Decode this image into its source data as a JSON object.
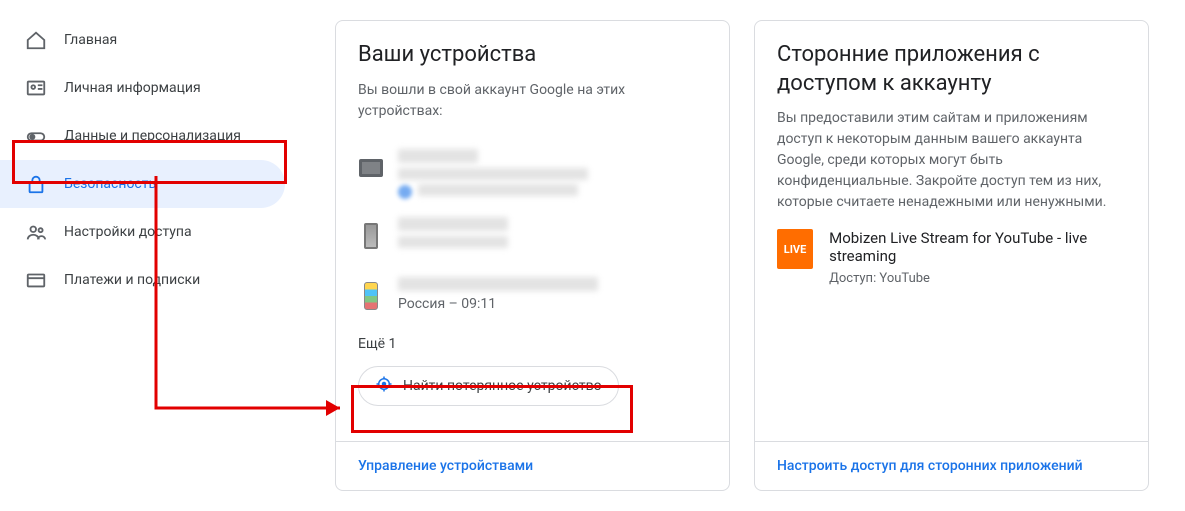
{
  "sidebar": {
    "items": [
      {
        "label": "Главная",
        "icon": "home-icon"
      },
      {
        "label": "Личная информация",
        "icon": "id-card-icon"
      },
      {
        "label": "Данные и персонализация",
        "icon": "toggle-icon"
      },
      {
        "label": "Безопасность",
        "icon": "lock-icon",
        "active": true
      },
      {
        "label": "Настройки доступа",
        "icon": "people-icon"
      },
      {
        "label": "Платежи и подписки",
        "icon": "card-icon"
      }
    ]
  },
  "devices_card": {
    "title": "Ваши устройства",
    "description": "Вы вошли в свой аккаунт Google на этих устройствах:",
    "devices": [
      {
        "name_redacted": true,
        "sub_redacted": true,
        "icon": "desktop"
      },
      {
        "name_redacted": true,
        "sub_redacted": true,
        "icon": "phone",
        "show_dot": true,
        "dot_color": "#1a73e8"
      },
      {
        "name_redacted": true,
        "sub": "Россия – 09:11",
        "icon": "samsung"
      }
    ],
    "more_label": "Ещё 1",
    "find_label": "Найти потерянное устройство",
    "footer_link": "Управление устройствами"
  },
  "apps_card": {
    "title": "Сторонние приложения с доступом к аккаунту",
    "description": "Вы предоставили этим сайтам и приложениям доступ к некоторым данным вашего аккаунта Google, среди которых могут быть конфиденциальные. Закройте доступ тем из них, которые считаете ненадежными или ненужными.",
    "app": {
      "icon_text": "LIVE",
      "icon_bg": "#ff6d00",
      "name": "Mobizen Live Stream for YouTube - live streaming",
      "access": "Доступ: YouTube"
    },
    "footer_link": "Настроить доступ для сторонних приложений"
  },
  "annotations": {
    "highlight_color": "#e20000"
  }
}
